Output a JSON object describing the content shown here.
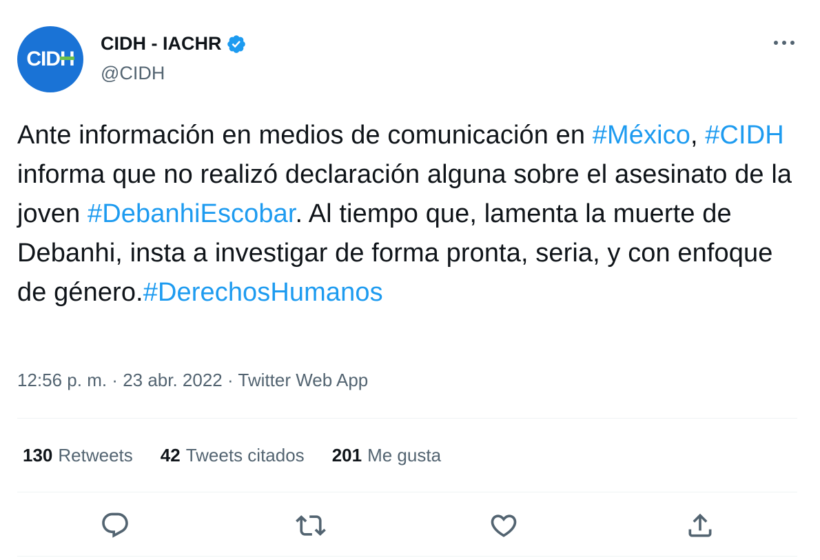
{
  "author": {
    "avatar_text_prefix": "CID",
    "avatar_text_h": "H",
    "display_name": "CIDH - IACHR",
    "handle": "@CIDH",
    "verified_icon": "verified-badge-icon"
  },
  "tweet": {
    "segments": [
      {
        "text": "Ante información en medios de comunicación en ",
        "hashtag": false
      },
      {
        "text": "#México",
        "hashtag": true
      },
      {
        "text": ", ",
        "hashtag": false
      },
      {
        "text": "#CIDH",
        "hashtag": true
      },
      {
        "text": " informa que no realizó declaración alguna sobre el asesinato de la joven ",
        "hashtag": false
      },
      {
        "text": "#DebanhiEscobar",
        "hashtag": true
      },
      {
        "text": ". Al tiempo que, lamenta la muerte de Debanhi, insta a investigar de forma pronta, seria, y con enfoque de género.",
        "hashtag": false
      },
      {
        "text": "#DerechosHumanos",
        "hashtag": true
      }
    ]
  },
  "meta": {
    "time": "12:56 p. m.",
    "sep1": " · ",
    "date": "23 abr. 2022",
    "sep2": " · ",
    "source": "Twitter Web App"
  },
  "stats": {
    "retweets": {
      "count": "130",
      "label": "Retweets"
    },
    "quotes": {
      "count": "42",
      "label": "Tweets citados"
    },
    "likes": {
      "count": "201",
      "label": "Me gusta"
    }
  },
  "icons": {
    "more": "more-dots-icon",
    "reply": "reply-icon",
    "retweet": "retweet-icon",
    "like": "heart-icon",
    "share": "share-icon"
  },
  "colors": {
    "accent": "#1d9bf0",
    "secondary_text": "#536471",
    "avatar_bg": "#1a73d6"
  }
}
